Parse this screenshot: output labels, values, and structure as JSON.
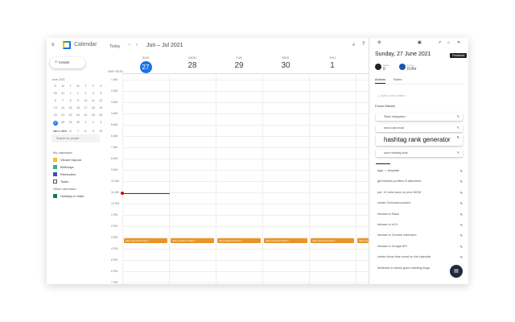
{
  "app": {
    "title": "Calendar",
    "today": "Today",
    "range": "Jun – Jul 2021",
    "create": "Create"
  },
  "mini": {
    "month": "June 2021",
    "dow": [
      "S",
      "M",
      "T",
      "W",
      "T",
      "F",
      "S"
    ],
    "days": [
      "30",
      "31",
      "1",
      "2",
      "3",
      "4",
      "5",
      "6",
      "7",
      "8",
      "9",
      "10",
      "11",
      "12",
      "13",
      "14",
      "15",
      "16",
      "17",
      "18",
      "19",
      "20",
      "21",
      "22",
      "23",
      "24",
      "25",
      "26",
      "27",
      "28",
      "29",
      "30",
      "1",
      "2",
      "3",
      "4",
      "5",
      "6",
      "7",
      "8",
      "9",
      "10"
    ],
    "selected": "27"
  },
  "sidebar": {
    "meet": "Meet with...",
    "search": "Search for people",
    "my_cal": "My calendars",
    "my_items": [
      "Vikrant Kapoor",
      "Birthdays",
      "Reminders",
      "Tasks"
    ],
    "other_cal": "Other calendars",
    "other_items": [
      "Holidays in India"
    ]
  },
  "days": [
    {
      "d": "SUN",
      "n": "27"
    },
    {
      "d": "MON",
      "n": "28"
    },
    {
      "d": "TUE",
      "n": "29"
    },
    {
      "d": "WED",
      "n": "30"
    },
    {
      "d": "THU",
      "n": "1"
    }
  ],
  "tz": "GMT+05:30",
  "times": [
    "1 AM",
    "2 AM",
    "3 AM",
    "4 AM",
    "5 AM",
    "6 AM",
    "7 AM",
    "8 AM",
    "9 AM",
    "10 AM",
    "11 AM",
    "12 PM",
    "1 PM",
    "2 PM",
    "3 PM",
    "4 PM",
    "5 PM",
    "6 PM",
    "7 PM"
  ],
  "events": [
    "daily standup 8:15pm",
    "daily standup 8:15pm",
    "daily standup 8:15pm",
    "daily standup 8:15pm",
    "daily standup 8:15pm",
    "daily standup"
  ],
  "panel": {
    "date": "Sunday, 27 June 2021",
    "stat1_label": "Tasks",
    "stat1": "0",
    "stat2_label": "Focus",
    "stat2": "0.0hr",
    "tabs": [
      "Actions",
      "Notes"
    ],
    "add": "Add a new action",
    "stream": "Focus Stream",
    "feedback": "Feedback",
    "cards": [
      "Slack integration",
      "send cold email",
      "hashtag rank generator",
      "save meeting slots"
    ],
    "tasks": [
      "tags -> template",
      "get linkedin profiles of attendees",
      "pm: 10 mins warn on prev MOM",
      "create Gumroad product",
      "release to Slack",
      "release to v0.5",
      "release to Chrome extension",
      "release to Google API",
      "create focus time event on the calendar",
      "feedback to detect good meeting blogs"
    ]
  }
}
